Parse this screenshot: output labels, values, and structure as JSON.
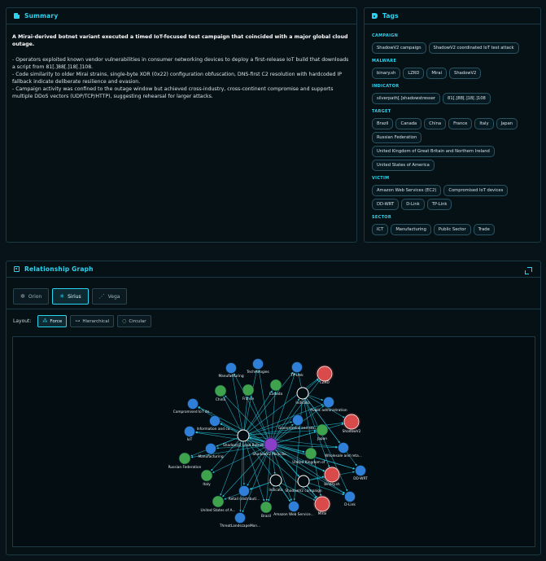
{
  "summary": {
    "header": "Summary",
    "title": "A Mirai-derived botnet variant executed a timed IoT-focused test campaign that coincided with a major global cloud outage.",
    "bullets": [
      "- Operators exploited known vendor vulnerabilities in consumer networking devices to deploy a first-release IoT build that downloads a script from 81[.]88[.]18[.]108.",
      "- Code similarity to older Mirai strains, single-byte XOR (0x22) configuration obfuscation, DNS-first C2 resolution with hardcoded IP fallback indicate deliberate resilience and evasion.",
      "- Campaign activity was confined to the outage window but achieved cross-industry, cross-continent compromise and supports multiple DDoS vectors (UDP/TCP/HTTP), suggesting rehearsal for larger attacks."
    ]
  },
  "tags": {
    "header": "Tags",
    "categories": [
      {
        "name": "CAMPAIGN",
        "items": [
          "ShadowV2 campaign",
          "ShadowV2 coordinated IoT test attack"
        ]
      },
      {
        "name": "MALWARE",
        "items": [
          "binary.sh",
          "LZRD",
          "Mirai",
          "ShadowV2"
        ]
      },
      {
        "name": "INDICATOR",
        "items": [
          "silverpath[.]shadowstresser",
          "81[.]88[.]18[.]108"
        ]
      },
      {
        "name": "TARGET",
        "items": [
          "Brazil",
          "Canada",
          "China",
          "France",
          "Italy",
          "Japan",
          "Russian Federation",
          "United Kingdom of Great Britain and Northern Ireland",
          "United States of America"
        ]
      },
      {
        "name": "VICTIM",
        "items": [
          "Amazon Web Services (EC2)",
          "Compromised IoT devices",
          "DD-WRT",
          "D-Link",
          "TP-Link"
        ]
      },
      {
        "name": "SECTOR",
        "items": [
          "ICT",
          "Manufacturing",
          "Public Sector",
          "Trade"
        ]
      }
    ]
  },
  "graph": {
    "header": "Relationship Graph",
    "styles": [
      {
        "label": "Orion",
        "icon": "orion-icon",
        "glyph": "✲",
        "active": false
      },
      {
        "label": "Sirius",
        "icon": "sirius-icon",
        "glyph": "✳",
        "active": true
      },
      {
        "label": "Vega",
        "icon": "vega-icon",
        "glyph": "⋰",
        "active": false
      }
    ],
    "layout_label": "Layout:",
    "layouts": [
      {
        "label": "Force",
        "icon": "force-icon",
        "glyph": "⁂",
        "active": true
      },
      {
        "label": "Hierarchical",
        "icon": "hierarchical-icon",
        "glyph": "⊶",
        "active": false
      },
      {
        "label": "Circular",
        "icon": "circular-icon",
        "glyph": "○",
        "active": false
      }
    ],
    "colors": {
      "blue": "#2f7fd8",
      "green": "#3fa34d",
      "red": "#d94a4a",
      "hub": "#8a3fc9",
      "ring": "#ffffff",
      "edge": "#2bd4f0"
    },
    "nodes": [
      {
        "id": "hub",
        "label": "ShadowV2 Mirai Bo...",
        "type": "hub"
      },
      {
        "id": "camp",
        "label": "ShadowV2 Lead Botnet",
        "type": "ring"
      },
      {
        "id": "ind1",
        "label": "Indicato",
        "type": "ring"
      },
      {
        "id": "ind2",
        "label": "Indicato",
        "type": "ring"
      },
      {
        "id": "ind3",
        "label": "ShadowV2 campaign",
        "type": "ring"
      },
      {
        "id": "manuf1",
        "label": "Manufacturing",
        "type": "blue"
      },
      {
        "id": "tech",
        "label": "Technologies",
        "type": "blue"
      },
      {
        "id": "tplink",
        "label": "TP-Link",
        "type": "blue"
      },
      {
        "id": "lzrd",
        "label": "LZRD",
        "type": "red"
      },
      {
        "id": "china",
        "label": "China",
        "type": "green"
      },
      {
        "id": "france",
        "label": "France",
        "type": "green"
      },
      {
        "id": "canada",
        "label": "Canada",
        "type": "green"
      },
      {
        "id": "pubadmin",
        "label": "Public administration",
        "type": "blue"
      },
      {
        "id": "shadowv2",
        "label": "ShadowV2",
        "type": "red"
      },
      {
        "id": "compiot",
        "label": "Compromised IoT de...",
        "type": "blue"
      },
      {
        "id": "infoco",
        "label": "Information and co...",
        "type": "blue"
      },
      {
        "id": "govt",
        "label": "Government and sta...",
        "type": "blue"
      },
      {
        "id": "japan",
        "label": "Japan",
        "type": "green"
      },
      {
        "id": "iot",
        "label": "IoT",
        "type": "blue"
      },
      {
        "id": "manuf2",
        "label": "Manufacturing",
        "type": "blue"
      },
      {
        "id": "russia",
        "label": "Russian Federation",
        "type": "green"
      },
      {
        "id": "uk",
        "label": "United Kingdom of ...",
        "type": "green"
      },
      {
        "id": "wholesale",
        "label": "Wholesale and reta...",
        "type": "blue"
      },
      {
        "id": "italy",
        "label": "Italy",
        "type": "green"
      },
      {
        "id": "binarysh",
        "label": "binary.sh",
        "type": "red"
      },
      {
        "id": "ddwrt",
        "label": "DD-WRT",
        "type": "blue"
      },
      {
        "id": "usa",
        "label": "United States of A...",
        "type": "green"
      },
      {
        "id": "retail",
        "label": "Retail (distributi...",
        "type": "blue"
      },
      {
        "id": "brazil",
        "label": "Brazil",
        "type": "green"
      },
      {
        "id": "aws",
        "label": "Amazon Web Service...",
        "type": "blue"
      },
      {
        "id": "mirai",
        "label": "Mirai",
        "type": "red"
      },
      {
        "id": "dlink",
        "label": "D-Link",
        "type": "blue"
      },
      {
        "id": "threat",
        "label": "ThreatLandscapeMon...",
        "type": "blue"
      }
    ]
  }
}
